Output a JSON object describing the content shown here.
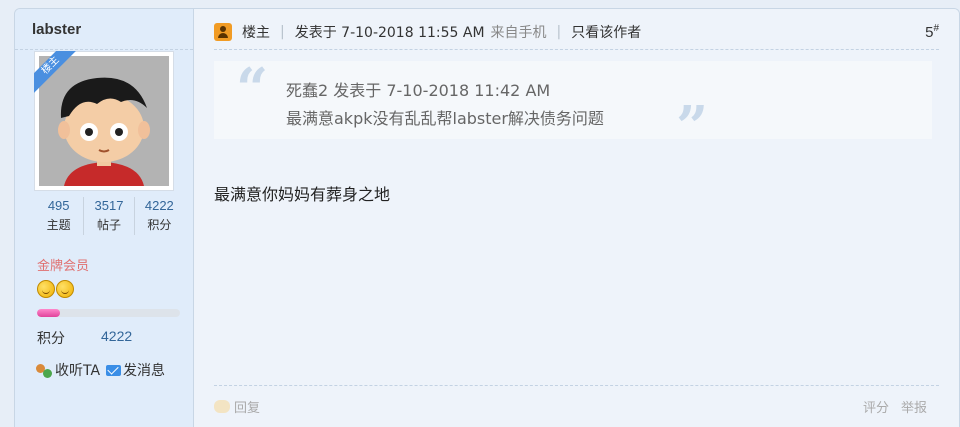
{
  "user": {
    "name": "labster",
    "badge": "楼主",
    "stats": [
      {
        "value": "495",
        "label": "主题"
      },
      {
        "value": "3517",
        "label": "帖子"
      },
      {
        "value": "4222",
        "label": "积分"
      }
    ],
    "rank": "金牌会员",
    "progress_percent": 16,
    "credit_label": "积分",
    "credit_value": "4222",
    "follow_label": "收听TA",
    "message_label": "发消息"
  },
  "post": {
    "host_label": "楼主",
    "posted_at": "发表于 7-10-2018 11:55 AM",
    "source": "来自手机",
    "only_author": "只看该作者",
    "floor_number": "5",
    "floor_mark": "#",
    "quote": {
      "author_line": "死蠢2 发表于 7-10-2018 11:42 AM",
      "text": "最满意akpk没有乱乱帮labster解决债务问题"
    },
    "message": "最满意你妈妈有葬身之地",
    "reply_label": "回复",
    "rate_label": "评分",
    "report_label": "举报"
  },
  "colors": {
    "accent": "#336699",
    "rank": "#e07070",
    "progress": "#e0439a"
  }
}
